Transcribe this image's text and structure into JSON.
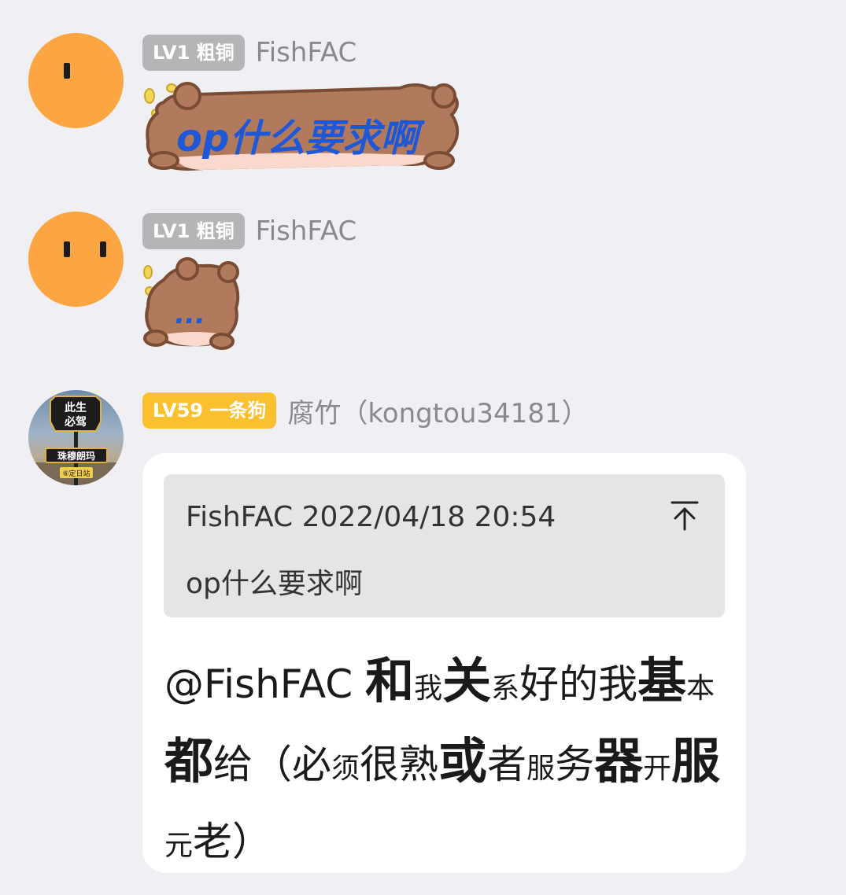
{
  "messages": [
    {
      "badge": "LV1 粗铜",
      "username": "FishFAC",
      "sticker_text": "op什么要求啊"
    },
    {
      "badge": "LV1 粗铜",
      "username": "FishFAC",
      "sticker_text": "..."
    },
    {
      "badge": "LV59 一条狗",
      "username": "腐竹（kongtou34181）",
      "avatar_sign": {
        "top": "此生",
        "top2": "必驾",
        "main": "珠穆朗玛",
        "bottom": "⑥定日站"
      },
      "quote": {
        "meta": "FishFAC 2022/04/18 20:54",
        "text": "op什么要求啊"
      },
      "reply_segments": [
        {
          "t": "@FishFAC ",
          "s": "n"
        },
        {
          "t": "和",
          "s": "big"
        },
        {
          "t": "我",
          "s": "sm"
        },
        {
          "t": "关",
          "s": "big"
        },
        {
          "t": "系",
          "s": "sm"
        },
        {
          "t": "好的我",
          "s": "n"
        },
        {
          "t": "基",
          "s": "big"
        },
        {
          "t": "本",
          "s": "sm"
        },
        {
          "t": "都",
          "s": "big"
        },
        {
          "t": "给（必",
          "s": "n"
        },
        {
          "t": "须",
          "s": "sm"
        },
        {
          "t": "很熟",
          "s": "n"
        },
        {
          "t": "或",
          "s": "big"
        },
        {
          "t": "者",
          "s": "n"
        },
        {
          "t": "服",
          "s": "sm"
        },
        {
          "t": "务",
          "s": "n"
        },
        {
          "t": "器",
          "s": "big"
        },
        {
          "t": "开",
          "s": "sm"
        },
        {
          "t": "服",
          "s": "big"
        },
        {
          "t": "元",
          "s": "sm"
        },
        {
          "t": "老）",
          "s": "n"
        }
      ]
    }
  ],
  "colors": {
    "background": "#f0eff4",
    "avatar_orange": "#fca543",
    "badge_gray": "#b5b5b8",
    "badge_gold": "#fbc02d",
    "sticker_text": "#1f58d6"
  },
  "icons": {
    "quote_jump": "arrow-up-to-top-icon"
  }
}
